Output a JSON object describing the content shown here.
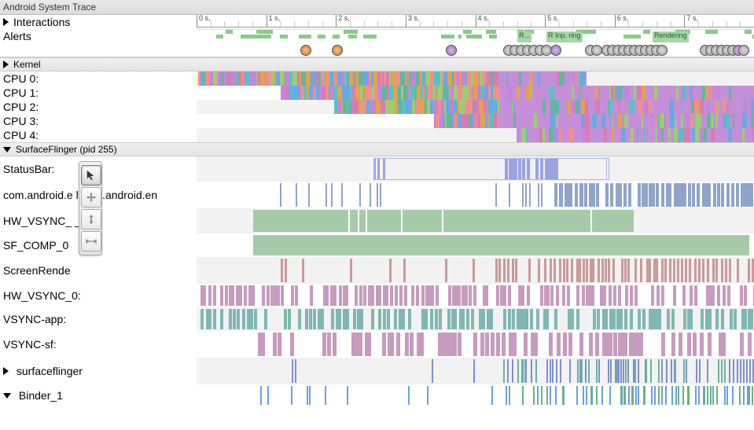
{
  "title": "Android System Trace",
  "timeAxis": {
    "start": 0,
    "end": 8,
    "unit": "s"
  },
  "rows": {
    "interactions": {
      "label": "Interactions"
    },
    "alerts": {
      "label": "Alerts"
    }
  },
  "overview_labels": [
    {
      "text": "R...",
      "t": 658
    },
    {
      "text": "Rendering",
      "t": 695
    },
    {
      "text": "Inp.",
      "t": 704
    },
    {
      "text": "Rendering",
      "t": 830
    }
  ],
  "sections": {
    "kernel": {
      "label": "Kernel"
    },
    "surfaceflinger": {
      "label": "SurfaceFlinger (pid 255)"
    }
  },
  "cpus": [
    {
      "label": "CPU 0:",
      "load": {
        "start": 252,
        "end": 746
      }
    },
    {
      "label": "CPU 1:",
      "load": {
        "start": 357,
        "end": 958
      }
    },
    {
      "label": "CPU 2:",
      "load": {
        "start": 425,
        "end": 958
      }
    },
    {
      "label": "CPU 3:",
      "load": {
        "start": 552,
        "end": 958
      }
    },
    {
      "label": "CPU 4:",
      "load": {
        "start": 657,
        "end": 958
      }
    }
  ],
  "sfTracks": [
    {
      "label": "StatusBar:"
    },
    {
      "label": "com.android.e        l/com.android.en"
    },
    {
      "label": "HW_VSYNC_        _0:"
    },
    {
      "label": "SF_COMP_0"
    },
    {
      "label": "ScreenRende"
    },
    {
      "label": "HW_VSYNC_0:"
    },
    {
      "label": "VSYNC-app:"
    },
    {
      "label": "VSYNC-sf:"
    },
    {
      "label": "surfaceflinger"
    },
    {
      "label": "Binder_1"
    }
  ],
  "tools": {
    "select": "select-tool",
    "pan": "pan-tool",
    "zoom": "zoom-tool",
    "timing": "timing-tool"
  }
}
